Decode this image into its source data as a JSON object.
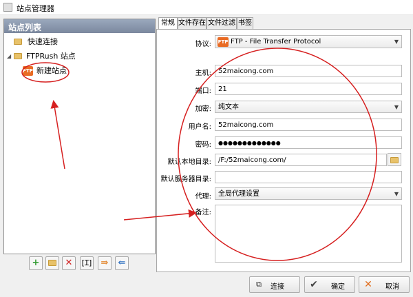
{
  "window": {
    "title": "站点管理器"
  },
  "site_list": {
    "header": "站点列表",
    "items": [
      {
        "label": "快速连接"
      },
      {
        "label": "FTPRush 站点"
      },
      {
        "label": "新建站点",
        "icon_text": "FTP"
      }
    ],
    "toolbar_icons": [
      "add-icon",
      "folder-icon",
      "delete-icon",
      "rename-icon",
      "import-icon",
      "export-icon"
    ]
  },
  "tabs": [
    "常规",
    "文件存在",
    "文件过滤",
    "书签"
  ],
  "form": {
    "protocol": {
      "label": "协议:",
      "value": "FTP - File Transfer Protocol",
      "icon_text": "FTP"
    },
    "host": {
      "label": "主机:",
      "value": "52maicong.com"
    },
    "port": {
      "label": "端口:",
      "value": "21"
    },
    "encryption": {
      "label": "加密:",
      "value": "纯文本"
    },
    "username": {
      "label": "用户名:",
      "value": "52maicong.com"
    },
    "password": {
      "label": "密码:",
      "value": "●●●●●●●●●●●●●"
    },
    "local_dir": {
      "label": "默认本地目录:",
      "value": "/F:/52maicong.com/"
    },
    "remote_dir": {
      "label": "默认服务器目录:",
      "value": ""
    },
    "proxy": {
      "label": "代理:",
      "value": "全局代理设置"
    },
    "notes": {
      "label": "备注:",
      "value": ""
    }
  },
  "buttons": {
    "connect": "连接",
    "ok": "确定",
    "cancel": "取消"
  },
  "colors": {
    "annotation": "#d62020",
    "header_gradient_top": "#9aa8bd",
    "ftp_orange": "#e96b24"
  }
}
